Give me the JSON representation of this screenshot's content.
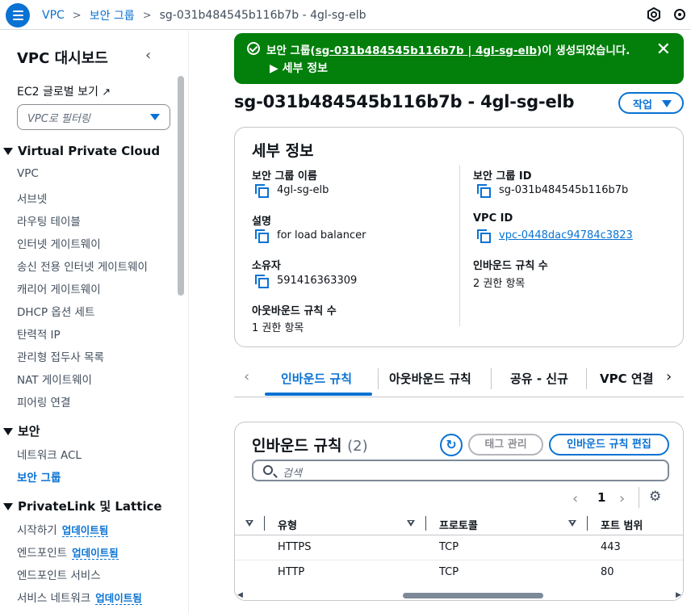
{
  "breadcrumb": {
    "items": [
      "VPC",
      "보안 그룹"
    ],
    "current": "sg-031b484545b116b7b - 4gl-sg-elb"
  },
  "sidebar": {
    "title": "VPC 대시보드",
    "ec2_link": "EC2 글로벌 보기",
    "filter_placeholder": "VPC로 필터링",
    "sections": [
      {
        "label": "Virtual Private Cloud",
        "items": [
          "VPC",
          "서브넷",
          "라우팅 테이블",
          "인터넷 게이트웨이",
          "송신 전용 인터넷 게이트웨이",
          "캐리어 게이트웨이",
          "DHCP 옵션 세트",
          "탄력적 IP",
          "관리형 접두사 목록",
          "NAT 게이트웨이",
          "피어링 연결"
        ]
      },
      {
        "label": "보안",
        "items": [
          "네트워크 ACL",
          "보안 그룹"
        ]
      },
      {
        "label": "PrivateLink 및 Lattice",
        "items": [
          "시작하기",
          "엔드포인트",
          "엔드포인트 서비스",
          "서비스 네트워크"
        ]
      }
    ],
    "badge": "업데이트됨"
  },
  "flash": {
    "message_prefix": "보안 그룹(",
    "message_link": "sg-031b484545b116b7b | 4gl-sg-elb",
    "message_suffix": ")이 생성되었습니다.",
    "detail_label": "세부 정보"
  },
  "page_title": "sg-031b484545b116b7b - 4gl-sg-elb",
  "actions_label": "작업",
  "details": {
    "heading": "세부 정보",
    "sg_name_label": "보안 그룹 이름",
    "sg_name": "4gl-sg-elb",
    "sg_id_label": "보안 그룹 ID",
    "sg_id": "sg-031b484545b116b7b",
    "desc_label": "설명",
    "desc": "for load balancer",
    "vpc_id_label": "VPC ID",
    "vpc_id": "vpc-0448dac94784c3823",
    "owner_label": "소유자",
    "owner": "591416363309",
    "inbound_count_label": "인바운드 규칙 수",
    "inbound_count": "2 권한 항목",
    "outbound_count_label": "아웃바운드 규칙 수",
    "outbound_count": "1 권한 항목"
  },
  "tabs": [
    "인바운드 규칙",
    "아웃바운드 규칙",
    "공유 - 신규",
    "VPC 연결"
  ],
  "rules": {
    "heading": "인바운드 규칙",
    "count": "(2)",
    "manage_tags": "태그 관리",
    "edit_rules": "인바운드 규칙 편집",
    "search_placeholder": "검색",
    "page": "1",
    "columns": [
      "유형",
      "프로토콜",
      "포트 범위"
    ],
    "rows": [
      {
        "type": "HTTPS",
        "protocol": "TCP",
        "port": "443"
      },
      {
        "type": "HTTP",
        "protocol": "TCP",
        "port": "80"
      }
    ]
  }
}
